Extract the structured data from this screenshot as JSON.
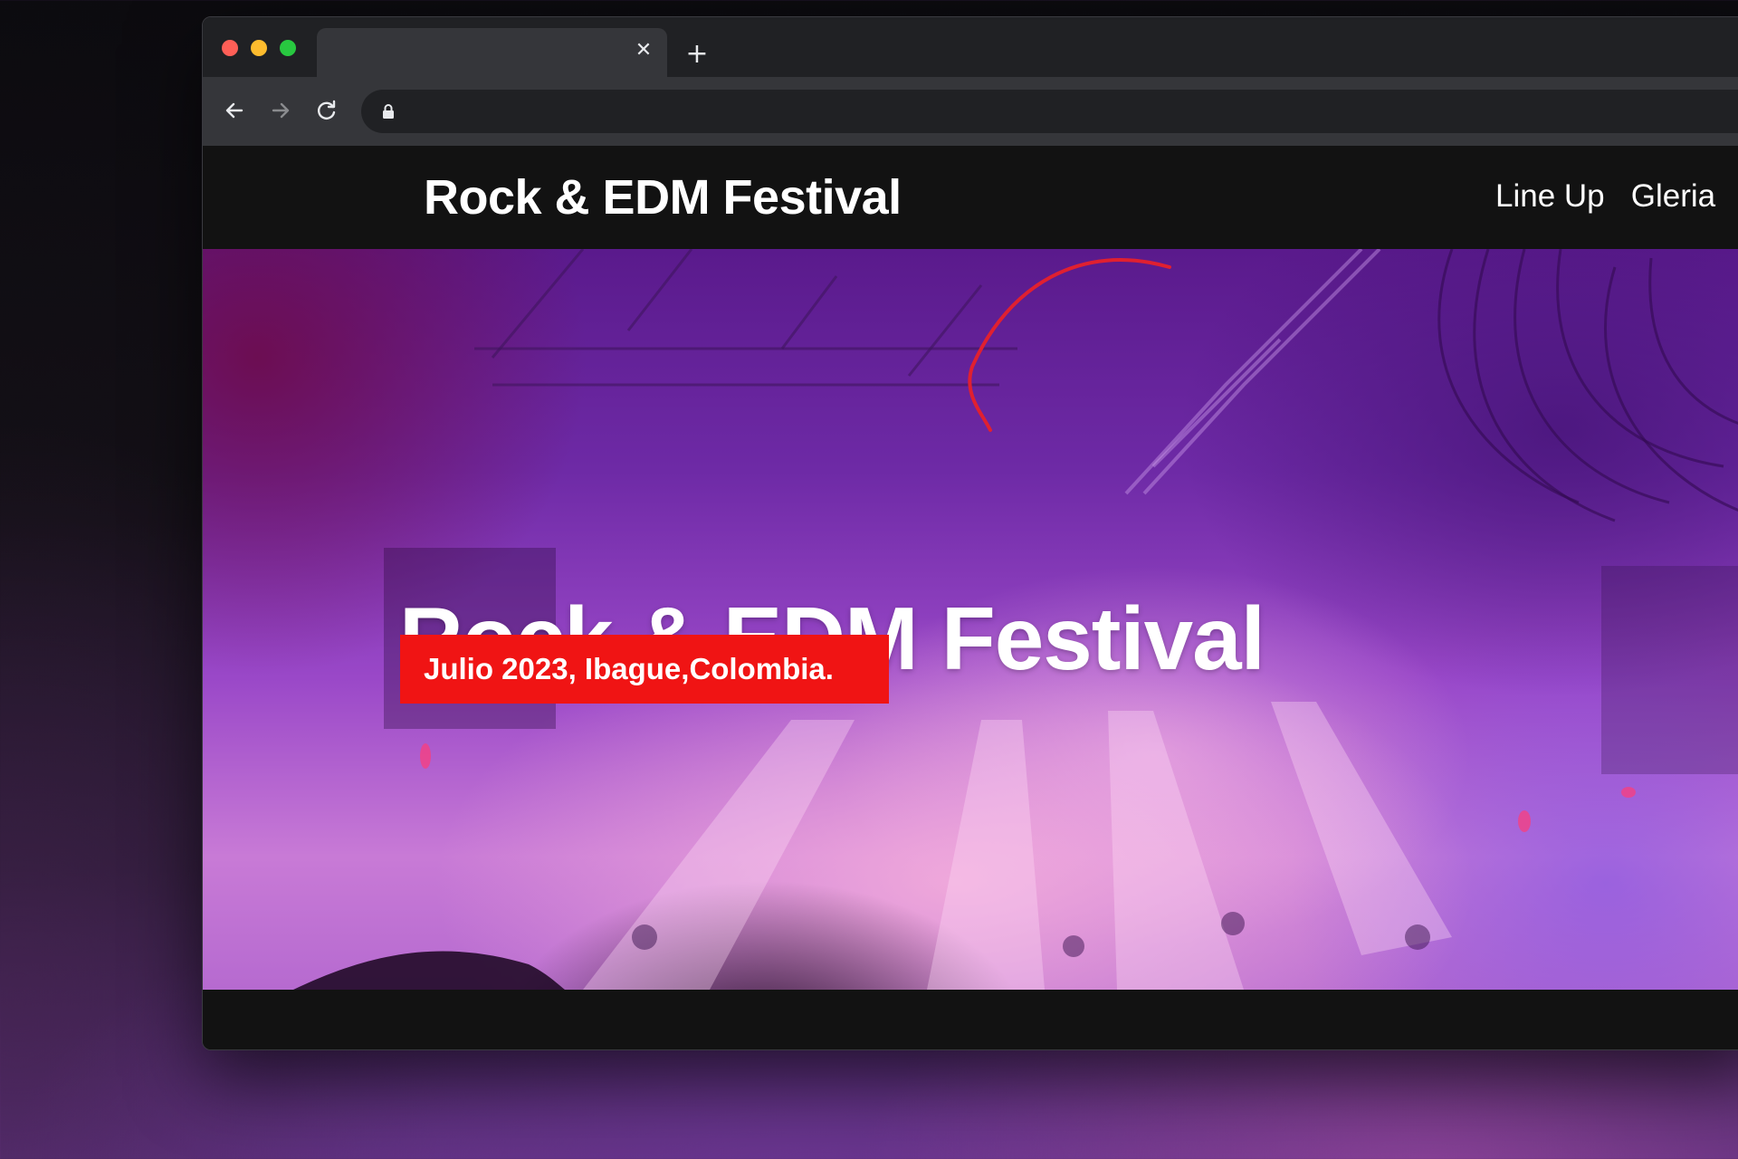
{
  "browser": {
    "tab": {
      "title": "",
      "close_glyph": "✕"
    },
    "new_tab_glyph": "+",
    "toolbar": {
      "back_icon": "arrow-left-icon",
      "forward_icon": "arrow-right-icon",
      "reload_icon": "reload-icon",
      "lock_icon": "lock-icon",
      "url": ""
    },
    "traffic_lights": {
      "red": "#ff5f57",
      "yellow": "#febc2e",
      "green": "#28c840"
    }
  },
  "site": {
    "logo": "Rock & EDM Festival",
    "nav": [
      "Line Up",
      "Gleria"
    ]
  },
  "hero": {
    "title": "Rock & EDM Festival",
    "subtitle": "Julio 2023, Ibague,Colombia.",
    "badge_color": "#f01414"
  }
}
